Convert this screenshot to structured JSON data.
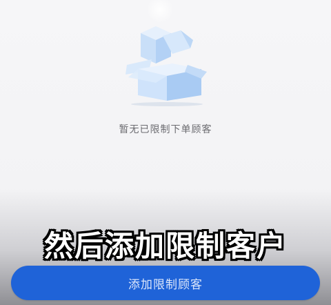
{
  "empty_state": {
    "illustration": "open-box-icon",
    "message": "暂无已限制下单顾客"
  },
  "caption": {
    "text": "然后添加限制客户"
  },
  "footer": {
    "add_button_label": "添加限制顾客"
  },
  "colors": {
    "primary": "#1f63d8",
    "box_light": "#cfe3fb",
    "box_mid": "#a9cbf3",
    "empty_text": "#6b6b70"
  }
}
